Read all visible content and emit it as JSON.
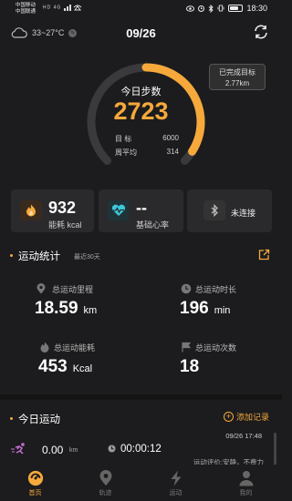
{
  "statusbar": {
    "carrier1": "中国移动",
    "carrier2": "中国联通",
    "net1": "HD 4G",
    "net2": "HD 4G",
    "time": "18:30",
    "battery_level": 0.7
  },
  "header": {
    "weather_temp": "33~27°C",
    "date": "09/26"
  },
  "steps": {
    "title": "今日步数",
    "count": "2723",
    "goal_label": "目 标",
    "goal_value": "6000",
    "avg_label": "周平均",
    "avg_value": "314",
    "progress": 0.454,
    "bubble_line1": "已完成目标",
    "bubble_line2": "2.77km"
  },
  "cards": {
    "kcal_value": "932",
    "kcal_label": "能耗 kcal",
    "hr_value": "--",
    "hr_label": "基础心率",
    "device_label": "未连接"
  },
  "stats": {
    "title": "运动统计",
    "subtitle": "最近30天",
    "distance_label": "总运动里程",
    "distance_value": "18.59",
    "distance_unit": "km",
    "duration_label": "总运动时长",
    "duration_value": "196",
    "duration_unit": "min",
    "energy_label": "总运动能耗",
    "energy_value": "453",
    "energy_unit": "Kcal",
    "count_label": "总运动次数",
    "count_value": "18"
  },
  "today": {
    "title": "今日运动",
    "add_record": "添加记录",
    "datetime": "09/26 17:48",
    "distance": "0.00",
    "distance_unit": "km",
    "duration": "00:00:12",
    "evaluation": "运动评价:安静，不费力"
  },
  "tabs": [
    {
      "label": "首页"
    },
    {
      "label": "轨迹"
    },
    {
      "label": "运动"
    },
    {
      "label": "我的"
    }
  ],
  "colors": {
    "accent": "#f6a93b",
    "background": "#1c1c1e",
    "card": "#2a2a2c"
  }
}
